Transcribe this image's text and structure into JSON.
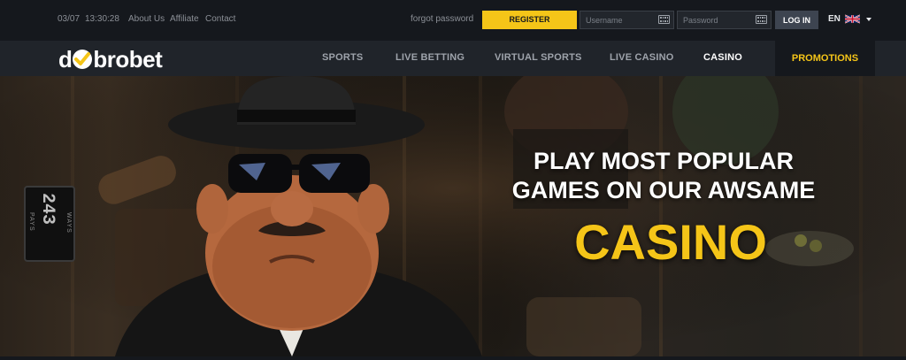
{
  "topbar": {
    "date": "03/07",
    "time": "13:30:28",
    "links": [
      {
        "label": "About Us"
      },
      {
        "label": "Affiliate"
      },
      {
        "label": "Contact"
      }
    ],
    "forgot_password": "forgot password",
    "register_label": "REGISTER",
    "username_placeholder": "Username",
    "password_placeholder": "Password",
    "login_label": "LOG IN",
    "language": "EN"
  },
  "logo": {
    "prefix": "d",
    "suffix": "brobet"
  },
  "nav": {
    "items": [
      {
        "label": "SPORTS"
      },
      {
        "label": "LIVE BETTING"
      },
      {
        "label": "VIRTUAL SPORTS"
      },
      {
        "label": "LIVE CASINO"
      },
      {
        "label": "CASINO"
      }
    ],
    "active": "CASINO",
    "promotions_label": "PROMOTIONS"
  },
  "hero": {
    "headline_line1": "PLAY MOST POPULAR",
    "headline_line2": "GAMES ON OUR AWSAME",
    "accent": "CASINO",
    "badge_number": "243",
    "badge_left": "PAYS",
    "badge_right": "WAYS"
  },
  "colors": {
    "accent_yellow": "#f5c518",
    "topbar_bg": "#15181d",
    "navbar_bg": "#20242a",
    "login_bg": "#3d4450"
  },
  "icons": [
    "keyboard-icon",
    "uk-flag-icon",
    "chevron-down-icon",
    "checkmark-ball-icon"
  ]
}
